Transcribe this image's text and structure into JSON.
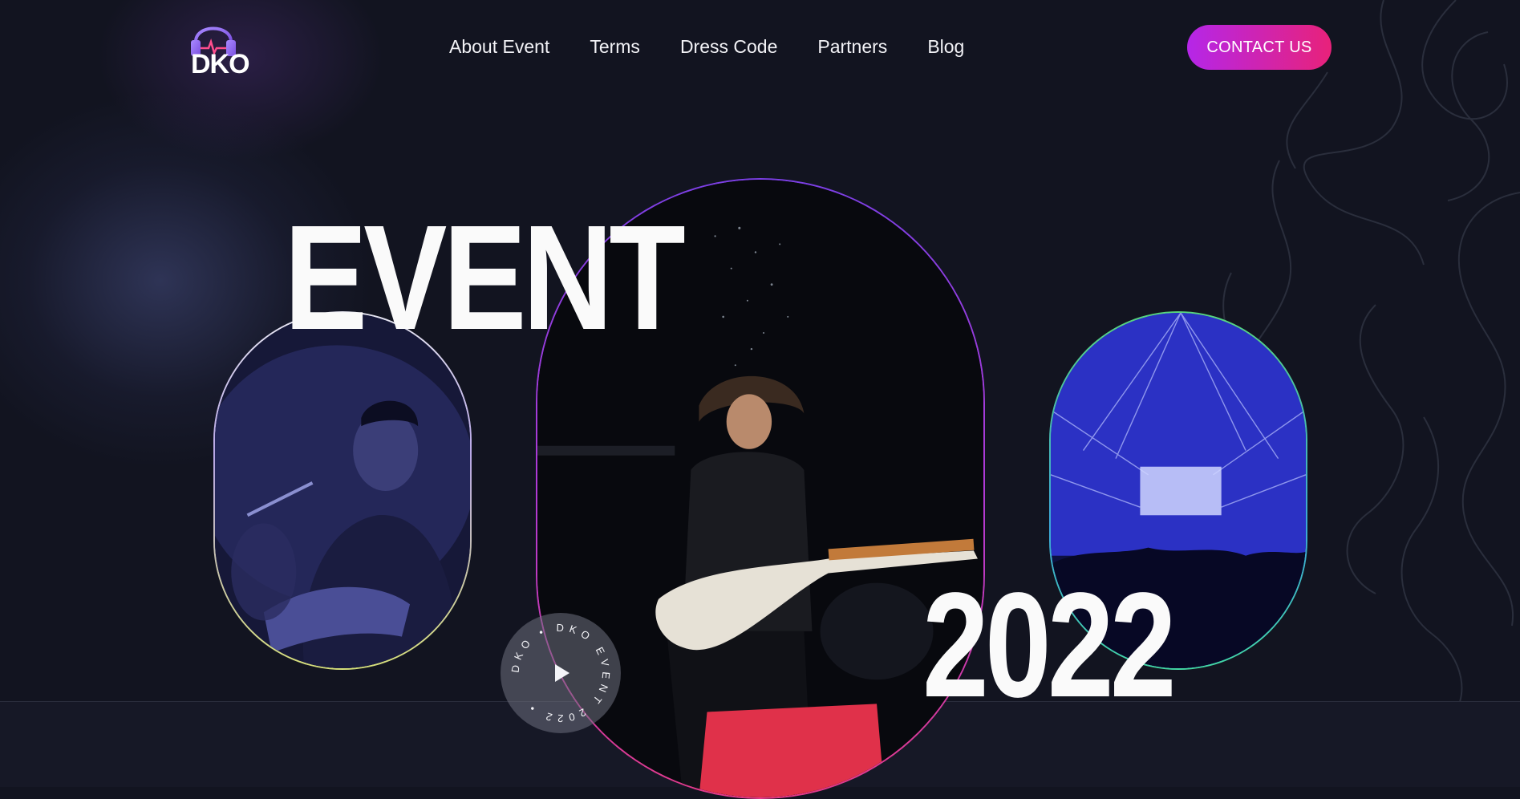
{
  "header": {
    "logo_text": "DKO",
    "nav": [
      "About Event",
      "Terms",
      "Dress Code",
      "Partners",
      "Blog"
    ],
    "contact_label": "CONTACT US"
  },
  "hero": {
    "title_top": "EVENT",
    "title_bottom": "2022",
    "badge_text": "DKO • DKO EVENT 2022 •"
  },
  "colors": {
    "background": "#121420",
    "accent_start": "#b526e8",
    "accent_end": "#e8227a"
  },
  "icons": [
    "headphones-logo-icon",
    "play-icon",
    "squiggle-pattern"
  ]
}
